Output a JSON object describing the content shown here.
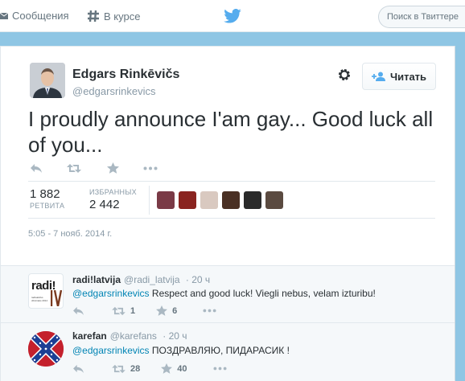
{
  "header": {
    "messages_label": "Сообщения",
    "moments_label": "В курсе",
    "search_placeholder": "Поиск в Твиттере"
  },
  "tweet": {
    "author_name": "Edgars Rinkēvičs",
    "author_handle": "@edgarsrinkevics",
    "follow_label": "Читать",
    "text": "I proudly announce I'am gay... Good luck all of you...",
    "retweets_count": "1 882",
    "retweets_label": "РЕТВИТА",
    "favorites_label": "ИЗБРАННЫХ",
    "favorites_count": "2 442",
    "timestamp": "5:05 - 7 нояб. 2014 г.",
    "favoriter_avatars": [
      "#7a3a46",
      "#8a2420",
      "#d9c9c0",
      "#4a3024",
      "#2a2a2a",
      "#5a4a40"
    ]
  },
  "replies": [
    {
      "name": "radi!latvija",
      "handle": "@radi_latvija",
      "time": "20 ч",
      "mention": "@edgarsrinkevics",
      "text": " Respect and good luck! Viegli nebus, velam izturibu!",
      "retweets": "1",
      "favorites": "6",
      "avatar_text": "radi!",
      "avatar_caption": "radioaktīvs dzīvnieks 2014"
    },
    {
      "name": "karefan",
      "handle": "@karefans",
      "time": "20 ч",
      "mention": "@edgarsrinkevics",
      "text": "  ПОЗДРАВЛЯЮ, ПИДАРАСИК !",
      "retweets": "28",
      "favorites": "40"
    }
  ],
  "icons": {
    "messages": "envelope-icon",
    "moments": "hash-icon",
    "logo": "twitter-bird-icon",
    "settings": "gear-icon",
    "follow": "add-user-icon",
    "reply": "reply-icon",
    "retweet": "retweet-icon",
    "favorite": "star-icon",
    "more": "more-icon"
  },
  "colors": {
    "accent": "#55acee",
    "link": "#0084b4",
    "background": "#8fc6e4",
    "icon_gray": "#aab8c2"
  }
}
